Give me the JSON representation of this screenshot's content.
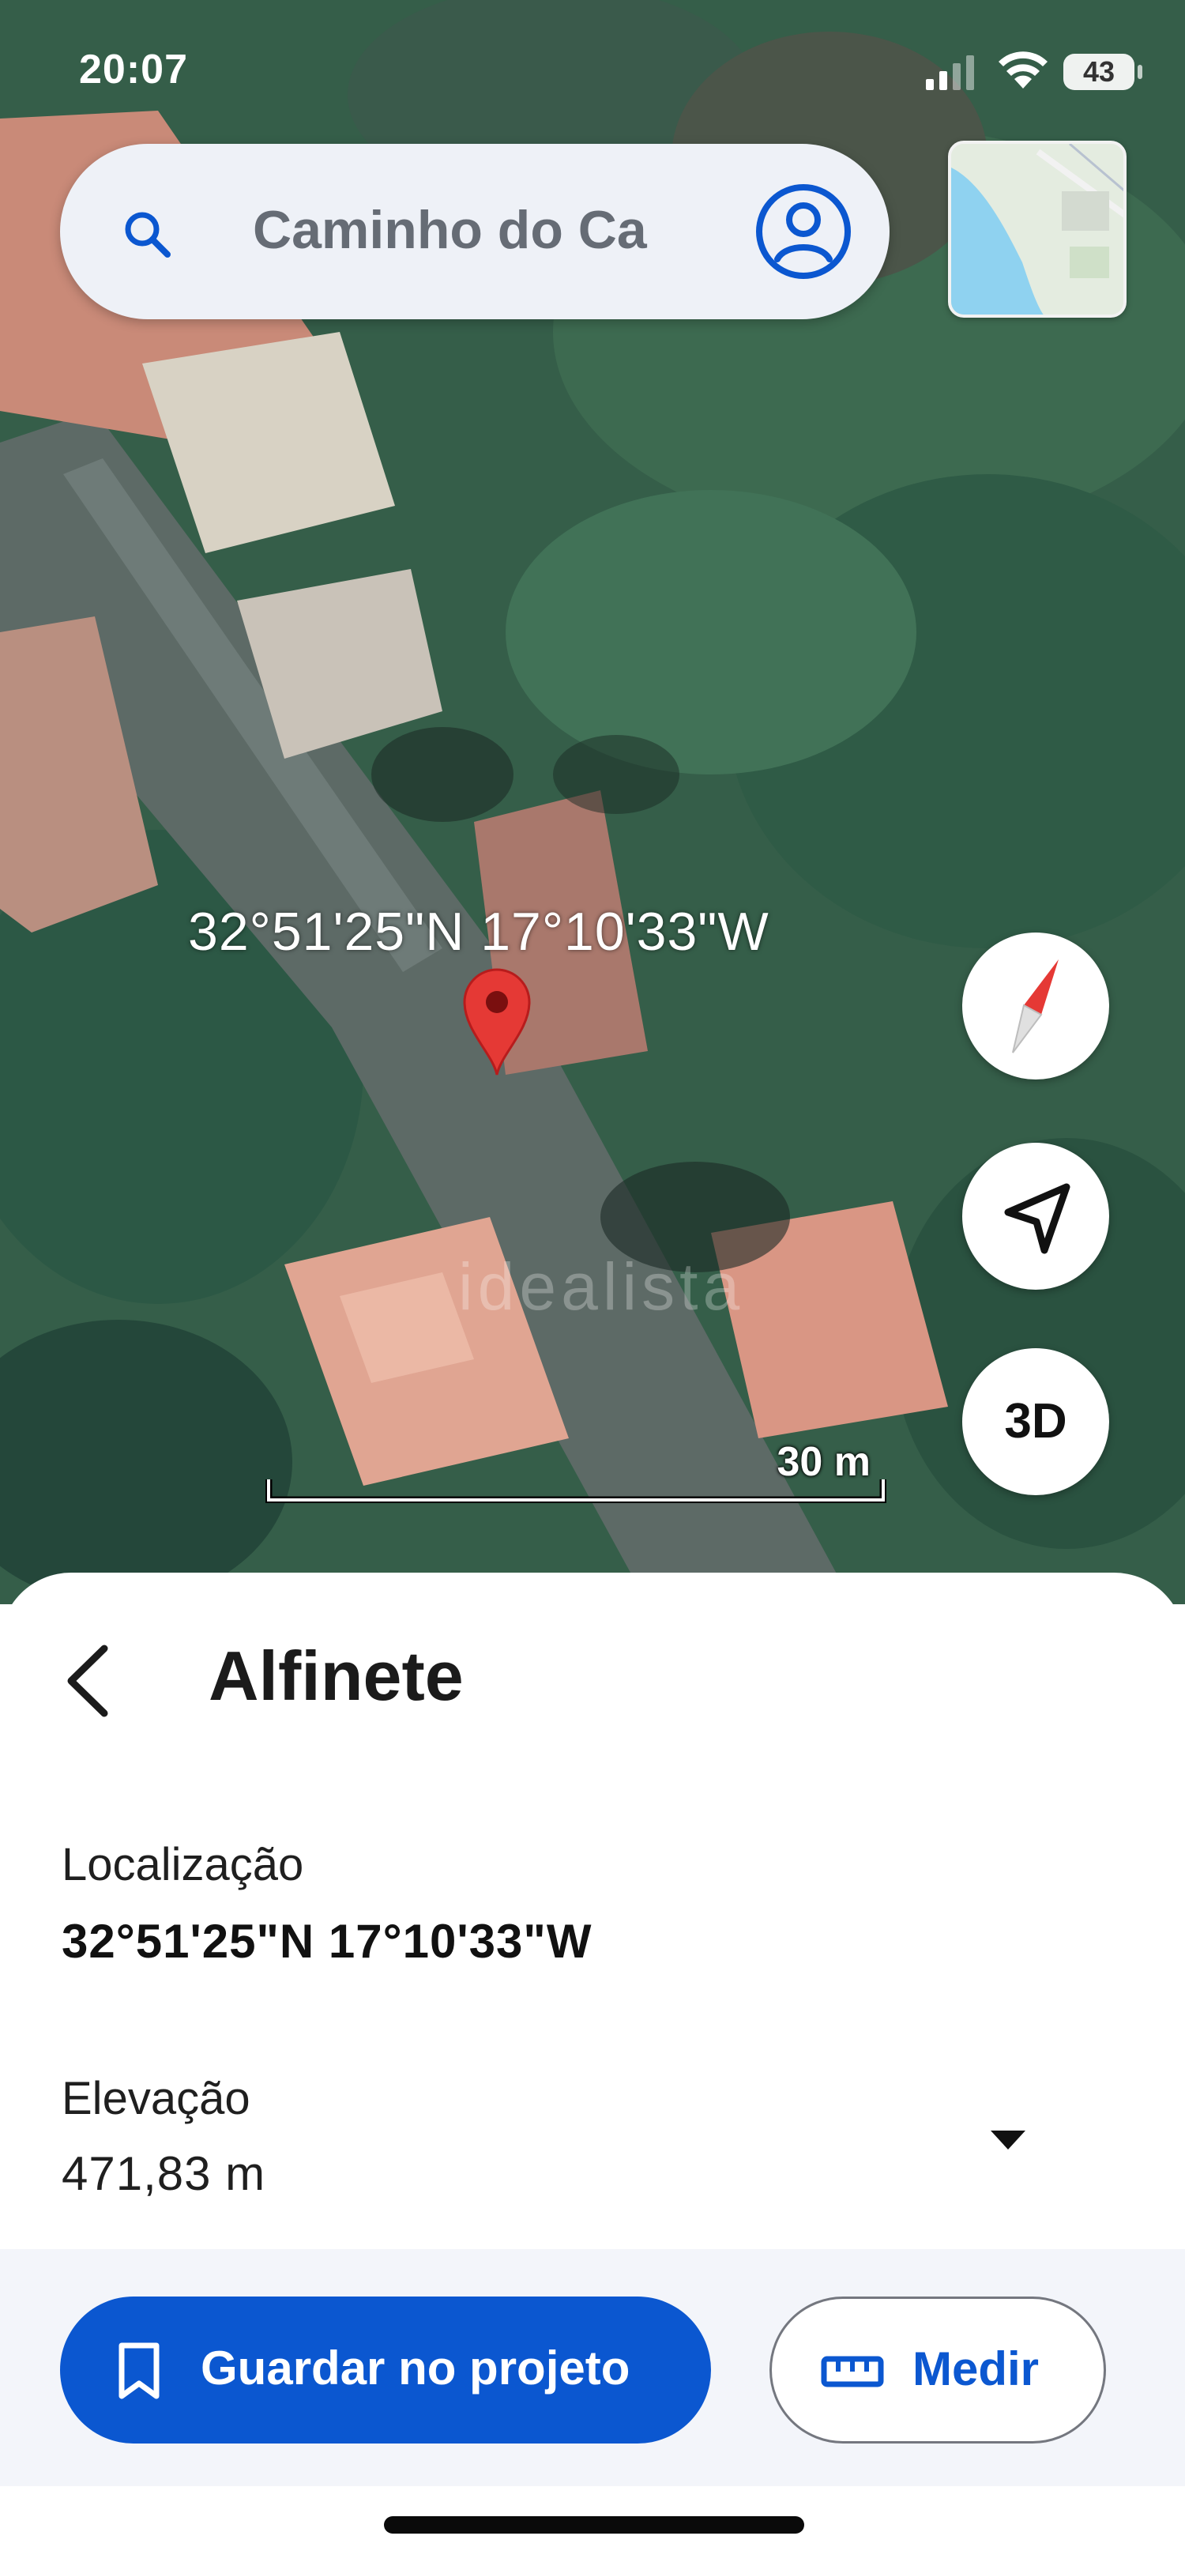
{
  "status_bar": {
    "time": "20:07",
    "battery": "43"
  },
  "search": {
    "text": "Caminho do Ca",
    "search_icon": "search-icon",
    "account_icon": "account-circle-icon"
  },
  "map": {
    "coordinates_label": "32°51'25\"N 17°10'33\"W",
    "watermark": "idealista",
    "scale_label": "30 m",
    "three_d_label": "3D",
    "compass_icon": "compass-icon",
    "location_icon": "navigation-arrow-icon",
    "pin_icon": "map-pin-icon",
    "pin_color": "#e53935"
  },
  "sheet": {
    "title": "Alfinete",
    "location_label": "Localização",
    "location_value": "32°51'25\"N 17°10'33\"W",
    "elevation_label": "Elevação",
    "elevation_value": "471,83 m"
  },
  "actions": {
    "save_label": "Guardar no projeto",
    "measure_label": "Medir",
    "save_icon": "bookmark-icon",
    "measure_icon": "ruler-icon",
    "accent_color": "#0b57d0"
  }
}
